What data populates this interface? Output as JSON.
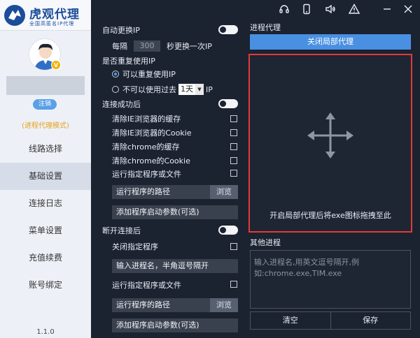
{
  "brand": {
    "title": "虎观代理",
    "subtitle": "全国高匿名IP代理"
  },
  "user": {
    "vip_badge": "V",
    "logout_label": "注销",
    "mode": "(进程代理模式)"
  },
  "nav": [
    "线路选择",
    "基础设置",
    "连接日志",
    "菜单设置",
    "充值续费",
    "账号绑定"
  ],
  "version": "1.1.0",
  "topbar_icons": [
    "headset-icon",
    "phone-icon",
    "speaker-icon",
    "warning-icon",
    "minimize-icon",
    "close-icon"
  ],
  "settings": {
    "auto_switch": "自动更换IP",
    "interval_prefix": "每隔",
    "interval_value": "300",
    "interval_suffix": "秒更换一次IP",
    "reuse_title": "是否重复使用IP",
    "reuse_yes": "可以重复使用IP",
    "reuse_no_prefix": "不可以使用过去",
    "reuse_period": "1天",
    "reuse_no_suffix": "IP",
    "after_connect": "连接成功后",
    "connect_items": [
      "清除IE浏览器的缓存",
      "清除IE浏览器的Cookie",
      "清除chrome的缓存",
      "清除chrome的Cookie",
      "运行指定程序或文件"
    ],
    "program_path": "运行程序的路径",
    "browse": "浏览",
    "program_args": "添加程序启动参数(可选)",
    "after_disconnect": "断开连接后",
    "close_program": "关闭指定程序",
    "process_input": "输入进程名，半角逗号隔开",
    "run_program": "运行指定程序或文件",
    "program_path2": "运行程序的路径",
    "browse2": "浏览",
    "program_args2": "添加程序启动参数(可选)"
  },
  "process_proxy": {
    "title": "进程代理",
    "close_button": "关闭局部代理",
    "drop_hint": "开启局部代理后将exe图标拖拽至此",
    "other_title": "其他进程",
    "other_placeholder_1": "输入进程名,用英文逗号隔开,例",
    "other_placeholder_2": "如:chrome.exe,TIM.exe",
    "clear_button": "清空",
    "save_button": "保存"
  },
  "colors": {
    "accent": "#4a90e2",
    "highlight": "#e23a3a",
    "background": "#1b2230",
    "sidebar": "#edf1f7"
  }
}
